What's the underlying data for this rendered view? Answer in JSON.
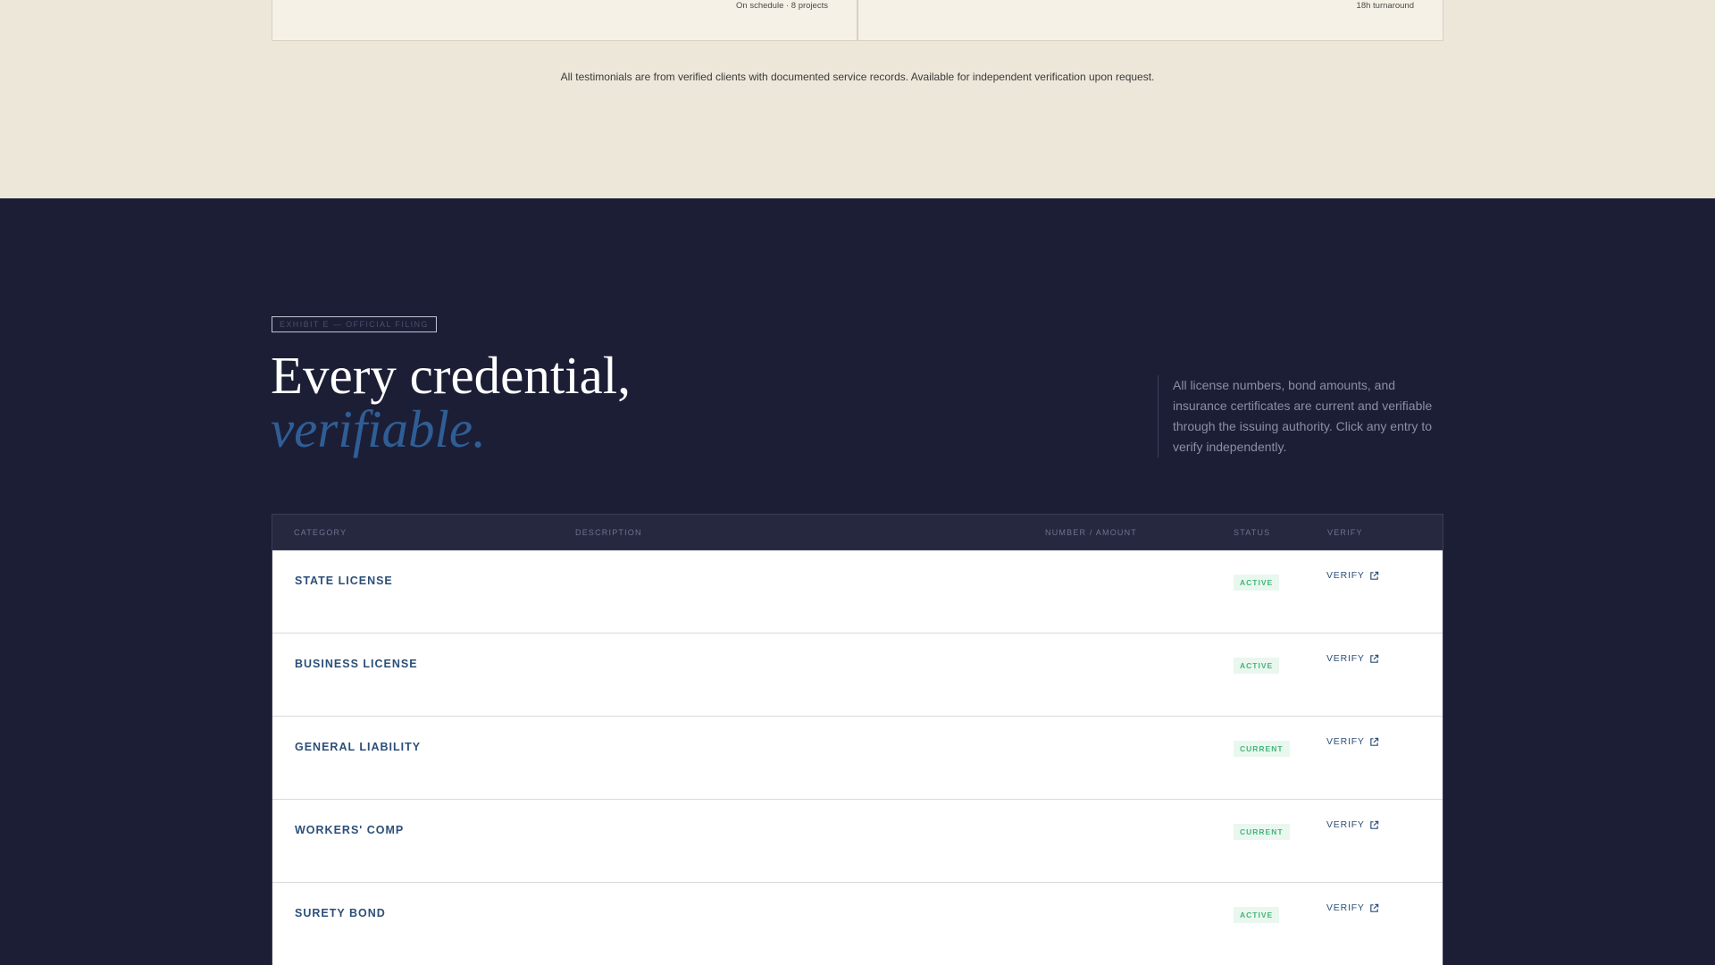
{
  "testimonials": {
    "cards": [
      {
        "meta": "On schedule · 8 projects"
      },
      {
        "meta": "18h turnaround"
      }
    ],
    "note": "All testimonials are from verified clients with documented service records. Available for independent verification upon request."
  },
  "credentials": {
    "exhibit_tag": "EXHIBIT E — OFFICIAL FILING",
    "headline_line1": "Every credential,",
    "headline_line2": "verifiable.",
    "intro": "All license numbers, bond amounts, and insurance certificates are current and verifiable through the issuing authority. Click any entry to verify independently.",
    "columns": {
      "category": "CATEGORY",
      "description": "DESCRIPTION",
      "number": "NUMBER / AMOUNT",
      "status": "STATUS",
      "verify": "VERIFY"
    },
    "rows": [
      {
        "category": "STATE LICENSE",
        "status": "ACTIVE",
        "verify": "VERIFY"
      },
      {
        "category": "BUSINESS LICENSE",
        "status": "ACTIVE",
        "verify": "VERIFY"
      },
      {
        "category": "GENERAL LIABILITY",
        "status": "CURRENT",
        "verify": "VERIFY"
      },
      {
        "category": "WORKERS' COMP",
        "status": "CURRENT",
        "verify": "VERIFY"
      },
      {
        "category": "SURETY BOND",
        "status": "ACTIVE",
        "verify": "VERIFY"
      }
    ]
  },
  "colors": {
    "cream_bg": "#ede7da",
    "dark_bg": "#1c1e36",
    "accent_blue": "#2f5e96",
    "status_green": "#43b67a"
  },
  "icons": {
    "verify": "external-link-icon"
  }
}
